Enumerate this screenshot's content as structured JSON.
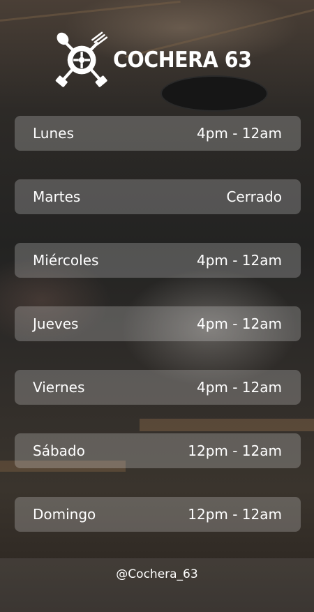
{
  "brand": {
    "name": "COCHERA 63",
    "logo_icon": "fork-spoon-wheel-pistons-icon"
  },
  "schedule": [
    {
      "day": "Lunes",
      "hours": "4pm - 12am"
    },
    {
      "day": "Martes",
      "hours": "Cerrado"
    },
    {
      "day": "Miércoles",
      "hours": "4pm - 12am"
    },
    {
      "day": "Jueves",
      "hours": "4pm - 12am"
    },
    {
      "day": "Viernes",
      "hours": "4pm - 12am"
    },
    {
      "day": "Sábado",
      "hours": "12pm - 12am"
    },
    {
      "day": "Domingo",
      "hours": "12pm - 12am"
    }
  ],
  "footer": {
    "handle": "@Cochera_63"
  },
  "colors": {
    "text": "#ffffff",
    "card": "rgba(255,255,255,0.22)"
  }
}
